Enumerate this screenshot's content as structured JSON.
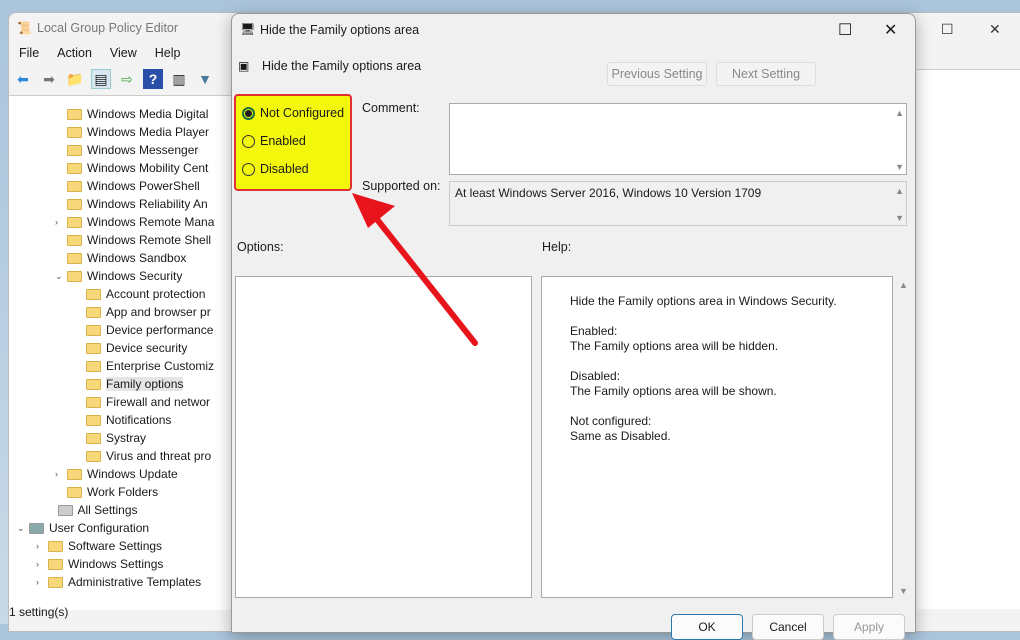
{
  "main": {
    "title": "Local Group Policy Editor",
    "menu": [
      "File",
      "Action",
      "View",
      "Help"
    ],
    "status": "1 setting(s)"
  },
  "tree": [
    {
      "label": "Windows Media Digital",
      "lvl": 2,
      "arr": ""
    },
    {
      "label": "Windows Media Player",
      "lvl": 2,
      "arr": ""
    },
    {
      "label": "Windows Messenger",
      "lvl": 2,
      "arr": ""
    },
    {
      "label": "Windows Mobility Cent",
      "lvl": 2,
      "arr": ""
    },
    {
      "label": "Windows PowerShell",
      "lvl": 2,
      "arr": ""
    },
    {
      "label": "Windows Reliability An",
      "lvl": 2,
      "arr": ""
    },
    {
      "label": "Windows Remote Mana",
      "lvl": 2,
      "arr": ">"
    },
    {
      "label": "Windows Remote Shell",
      "lvl": 2,
      "arr": ""
    },
    {
      "label": "Windows Sandbox",
      "lvl": 2,
      "arr": ""
    },
    {
      "label": "Windows Security",
      "lvl": 2,
      "arr": "v"
    },
    {
      "label": "Account protection",
      "lvl": 3,
      "arr": ""
    },
    {
      "label": "App and browser pr",
      "lvl": 3,
      "arr": ""
    },
    {
      "label": "Device performance",
      "lvl": 3,
      "arr": ""
    },
    {
      "label": "Device security",
      "lvl": 3,
      "arr": ""
    },
    {
      "label": "Enterprise Customiz",
      "lvl": 3,
      "arr": ""
    },
    {
      "label": "Family options",
      "lvl": 3,
      "arr": "",
      "sel": true
    },
    {
      "label": "Firewall and networ",
      "lvl": 3,
      "arr": ""
    },
    {
      "label": "Notifications",
      "lvl": 3,
      "arr": ""
    },
    {
      "label": "Systray",
      "lvl": 3,
      "arr": ""
    },
    {
      "label": "Virus and threat pro",
      "lvl": 3,
      "arr": ""
    },
    {
      "label": "Windows Update",
      "lvl": 2,
      "arr": ">"
    },
    {
      "label": "Work Folders",
      "lvl": 2,
      "arr": ""
    },
    {
      "label": "All Settings",
      "lvl": 1.5,
      "arr": "",
      "icon": "settings"
    },
    {
      "label": "User Configuration",
      "lvl": 0,
      "arr": "v",
      "icon": "user"
    },
    {
      "label": "Software Settings",
      "lvl": 1,
      "arr": ">"
    },
    {
      "label": "Windows Settings",
      "lvl": 1,
      "arr": ">"
    },
    {
      "label": "Administrative Templates",
      "lvl": 1,
      "arr": ">"
    }
  ],
  "dialog": {
    "title": "Hide the Family options area",
    "subtitle": "Hide the Family options area",
    "prev": "Previous Setting",
    "next": "Next Setting",
    "radios": {
      "not_configured": "Not Configured",
      "enabled": "Enabled",
      "disabled": "Disabled",
      "selected": "not_configured"
    },
    "comment_label": "Comment:",
    "comment": "",
    "supported_label": "Supported on:",
    "supported": "At least Windows Server 2016, Windows 10 Version 1709",
    "options_label": "Options:",
    "help_label": "Help:",
    "help": [
      "Hide the Family options area in Windows Security.",
      "Enabled:",
      "The Family options area will be hidden.",
      "Disabled:",
      "The Family options area will be shown.",
      "Not configured:",
      "Same as Disabled."
    ],
    "ok": "OK",
    "cancel": "Cancel",
    "apply": "Apply"
  },
  "colors": {
    "highlight": "#f2f70b",
    "annotation": "#e23030"
  }
}
